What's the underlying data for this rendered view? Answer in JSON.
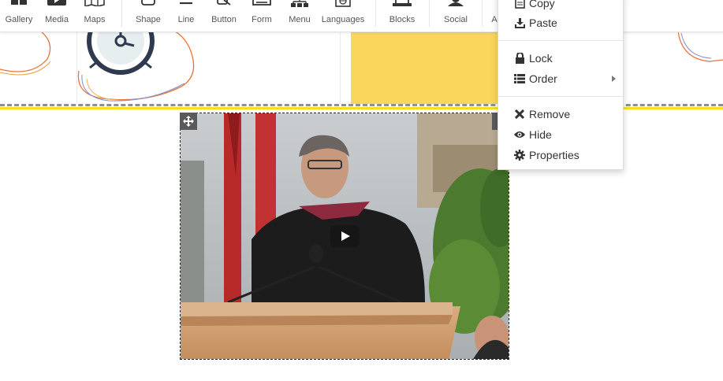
{
  "toolbar": {
    "items": [
      {
        "label": "Gallery",
        "icon": "gallery-icon"
      },
      {
        "label": "Media",
        "icon": "media-icon"
      },
      {
        "label": "Maps",
        "icon": "maps-icon"
      },
      {
        "label": "Shape",
        "icon": "shape-icon"
      },
      {
        "label": "Line",
        "icon": "line-icon"
      },
      {
        "label": "Button",
        "icon": "button-icon"
      },
      {
        "label": "Form",
        "icon": "form-icon"
      },
      {
        "label": "Menu",
        "icon": "menu-icon"
      },
      {
        "label": "Languages",
        "icon": "languages-icon"
      },
      {
        "label": "Blocks",
        "icon": "blocks-icon"
      },
      {
        "label": "Social",
        "icon": "social-icon"
      },
      {
        "label": "A",
        "icon": "more-icon"
      }
    ]
  },
  "context_menu": {
    "items": [
      {
        "label": "Copy",
        "icon": "copy-icon"
      },
      {
        "label": "Paste",
        "icon": "paste-icon"
      },
      {
        "label": "Lock",
        "icon": "lock-icon"
      },
      {
        "label": "Order",
        "icon": "order-icon"
      },
      {
        "label": "Remove",
        "icon": "remove-icon"
      },
      {
        "label": "Hide",
        "icon": "eye-icon"
      },
      {
        "label": "Properties",
        "icon": "gear-icon"
      }
    ]
  },
  "canvas": {
    "accent_yellow": "#f9d65c",
    "divider_yellow": "#f2e21e"
  },
  "video": {
    "play_icon": "play-icon",
    "move_icon": "move-icon"
  }
}
